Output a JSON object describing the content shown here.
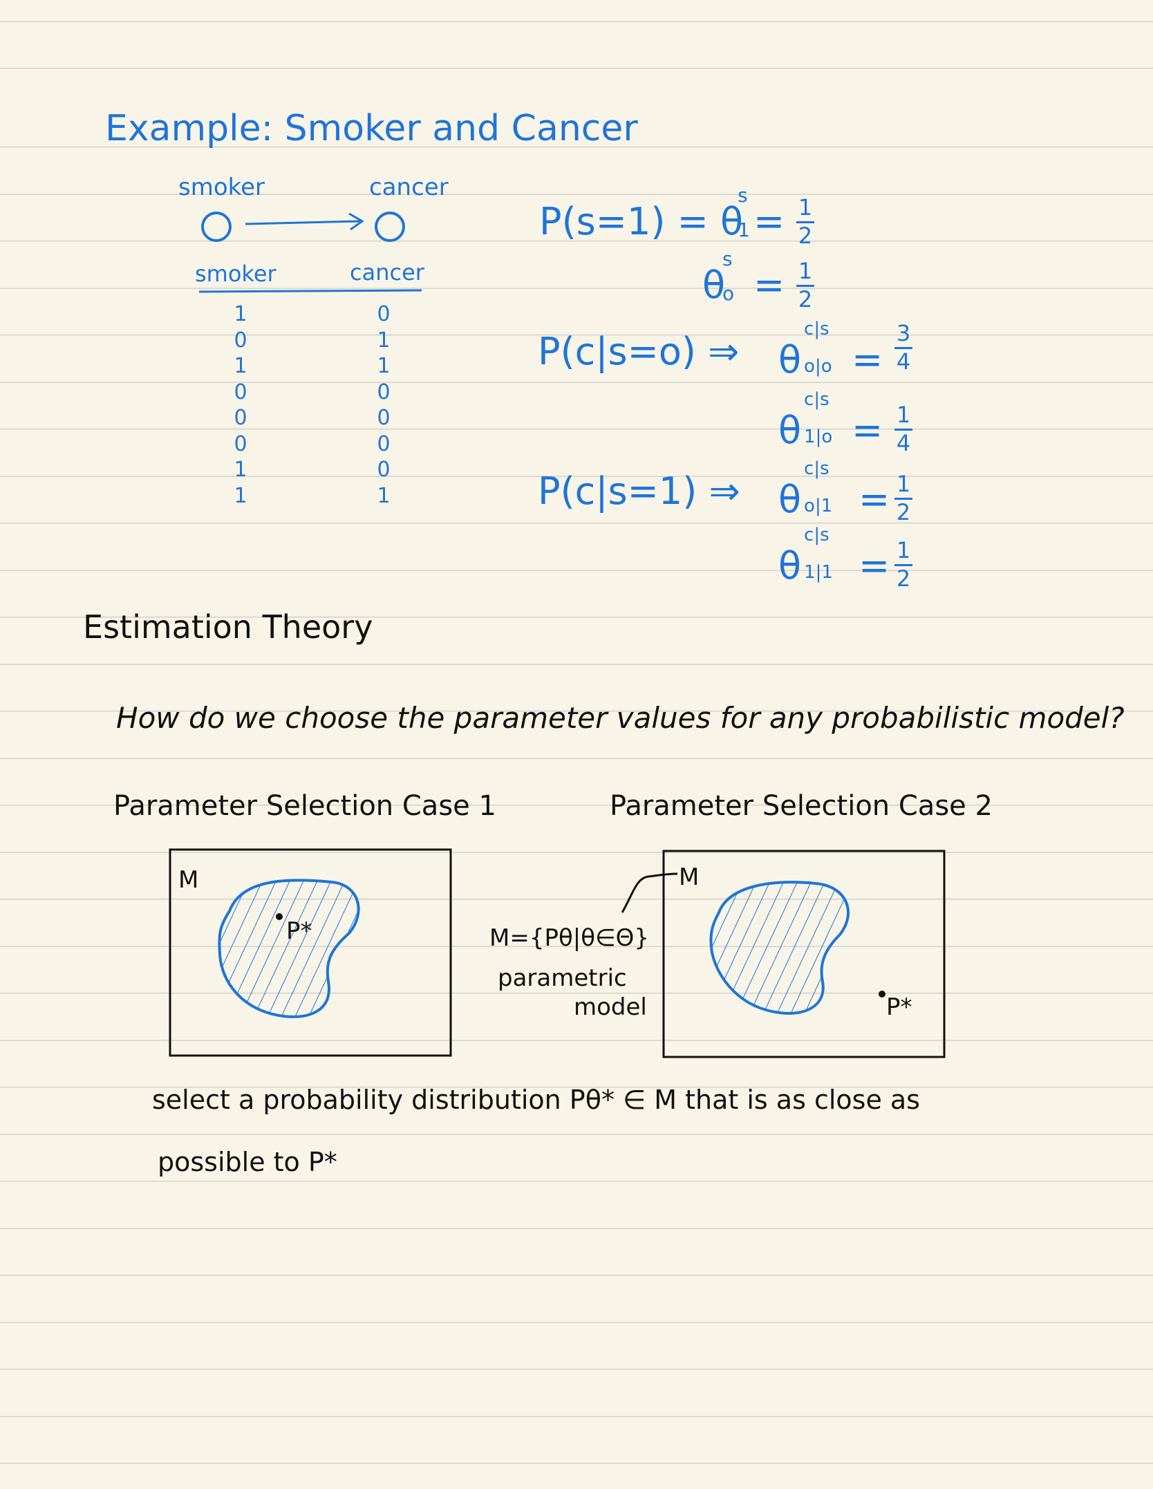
{
  "example": {
    "title": "Example: Smoker and Cancer",
    "node_smoker": "smoker",
    "node_cancer": "cancer",
    "col_smoker": "smoker",
    "col_cancer": "cancer",
    "smoker_values": [
      "1",
      "0",
      "1",
      "0",
      "0",
      "0",
      "1",
      "1"
    ],
    "cancer_values": [
      "0",
      "1",
      "1",
      "0",
      "0",
      "0",
      "0",
      "1"
    ]
  },
  "equations": {
    "p_s1": "P(s=1) = θ",
    "p_s1_sup": "s",
    "p_s1_sub": "1",
    "eq1": "=",
    "frac1_num": "1",
    "frac1_den": "2",
    "theta0": "θ",
    "theta0_sup": "s",
    "theta0_sub": "o",
    "eq2": "=",
    "frac2_num": "1",
    "frac2_den": "2",
    "p_c_s0": "P(c|s=o) ⇒",
    "t_010": "θ",
    "t_010_sup": "c|s",
    "t_010_sub": "o|o",
    "frac3_num": "3",
    "frac3_den": "4",
    "t_110": "θ",
    "t_110_sup": "c|s",
    "t_110_sub": "1|o",
    "frac4_num": "1",
    "frac4_den": "4",
    "p_c_s1": "P(c|s=1) ⇒",
    "t_011": "θ",
    "t_011_sup": "c|s",
    "t_011_sub": "o|1",
    "frac5_num": "1",
    "frac5_den": "2",
    "t_111": "θ",
    "t_111_sup": "c|s",
    "t_111_sub": "1|1",
    "frac6_num": "1",
    "frac6_den": "2",
    "equals": "="
  },
  "estimation": {
    "heading": "Estimation Theory",
    "question": "How do we choose the parameter values for any probabilistic model?",
    "case1": "Parameter Selection Case 1",
    "case2": "Parameter Selection Case 2",
    "box_label_1": "M",
    "box_label_2": "M",
    "pstar_1": "P*",
    "pstar_2": "P*",
    "model_def": "M={Pθ|θ∈Θ}",
    "model_name_1": "parametric",
    "model_name_2": "model",
    "select_line_1": "select a probability distribution Pθ* ∈ M that is as close as",
    "select_line_2": "possible to P*"
  },
  "colors": {
    "blue": "#1f74d8",
    "ink": "#111111",
    "paper": "#f8f5e8",
    "rule": "#d9d7cf"
  }
}
